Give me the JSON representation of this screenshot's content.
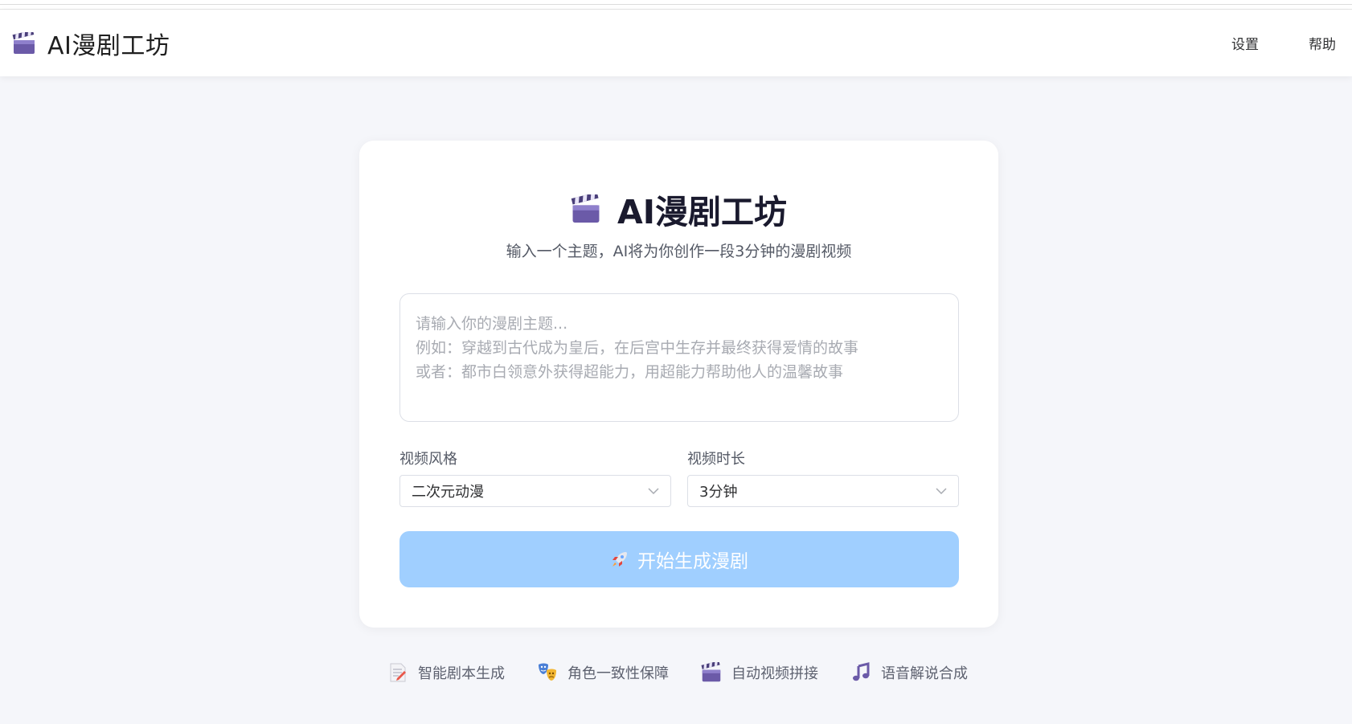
{
  "header": {
    "brand_title": "AI漫剧工坊",
    "nav": {
      "settings": "设置",
      "help": "帮助"
    }
  },
  "card": {
    "title": "AI漫剧工坊",
    "subtitle": "输入一个主题，AI将为你创作一段3分钟的漫剧视频",
    "topic_input": {
      "value": "",
      "placeholder": "请输入你的漫剧主题...\n例如：穿越到古代成为皇后，在后宫中生存并最终获得爱情的故事\n或者：都市白领意外获得超能力，用超能力帮助他人的温馨故事"
    },
    "style_label": "视频风格",
    "style_value": "二次元动漫",
    "duration_label": "视频时长",
    "duration_value": "3分钟",
    "generate_button": "开始生成漫剧"
  },
  "features": [
    {
      "label": "智能剧本生成",
      "icon": "memo-icon"
    },
    {
      "label": "角色一致性保障",
      "icon": "theater-masks-icon"
    },
    {
      "label": "自动视频拼接",
      "icon": "clapperboard-icon"
    },
    {
      "label": "语音解说合成",
      "icon": "music-note-icon"
    }
  ],
  "colors": {
    "primary_disabled": "#a0cfff",
    "background": "#f5f6fa",
    "clapper": "#6b5aa8"
  }
}
